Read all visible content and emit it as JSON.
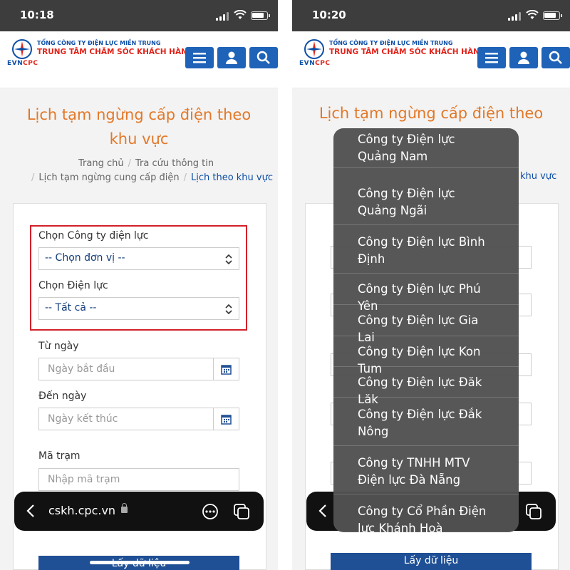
{
  "screens": [
    {
      "time": "10:18",
      "header": {
        "org_line": "TỔNG CÔNG TY ĐIỆN LỰC MIỀN TRUNG",
        "center_line": "TRUNG TÂM CHĂM SÓC KHÁCH HÀNG",
        "logo_evn": "EVN",
        "logo_cpc": "CPC"
      },
      "page_title_line1": "Lịch tạm ngừng cấp điện theo",
      "page_title_line2": "khu vực",
      "breadcrumb": {
        "home": "Trang chủ",
        "lookup": "Tra cứu thông tin",
        "outage": "Lịch tạm ngừng cung cấp điện",
        "current": "Lịch theo khu vực"
      },
      "form": {
        "company_label": "Chọn Công ty điện lực",
        "company_value": "-- Chọn đơn vị --",
        "district_label": "Chọn Điện lực",
        "district_value": "-- Tất cả --",
        "from_label": "Từ ngày",
        "from_placeholder": "Ngày bắt đầu",
        "to_label": "Đến ngày",
        "to_placeholder": "Ngày kết thúc",
        "station_label": "Mã trạm",
        "station_placeholder": "Nhập mã trạm",
        "submit_label": "Lấy dữ liệu"
      },
      "browser": {
        "url": "cskh.cpc.vn"
      }
    },
    {
      "time": "10:20",
      "page_title_line1": "Lịch tạm ngừng cấp điện theo",
      "breadcrumb_partial": "khu vực",
      "form": {
        "submit_label": "Lấy dữ liệu"
      },
      "picker": {
        "options": [
          "Công ty Điện lực Quảng Nam",
          "Công ty Điện lực Quảng Ngãi",
          "Công ty Điện lực Bình Định",
          "Công ty Điện lực Phú Yên",
          "Công ty Điện lực Gia Lai",
          "Công ty Điện lực Kon Tum",
          "Công ty Điện lực Đăk Lăk",
          "Công ty Điện lực Đắk Nông",
          "Công ty TNHH MTV Điện lực Đà Nẵng",
          "Công ty Cổ Phần Điện lực Khánh Hoà"
        ]
      }
    }
  ],
  "colors": {
    "accent": "#1f63b8",
    "title": "#e27828",
    "highlight": "#d32029",
    "brand_red": "#e2231a"
  }
}
